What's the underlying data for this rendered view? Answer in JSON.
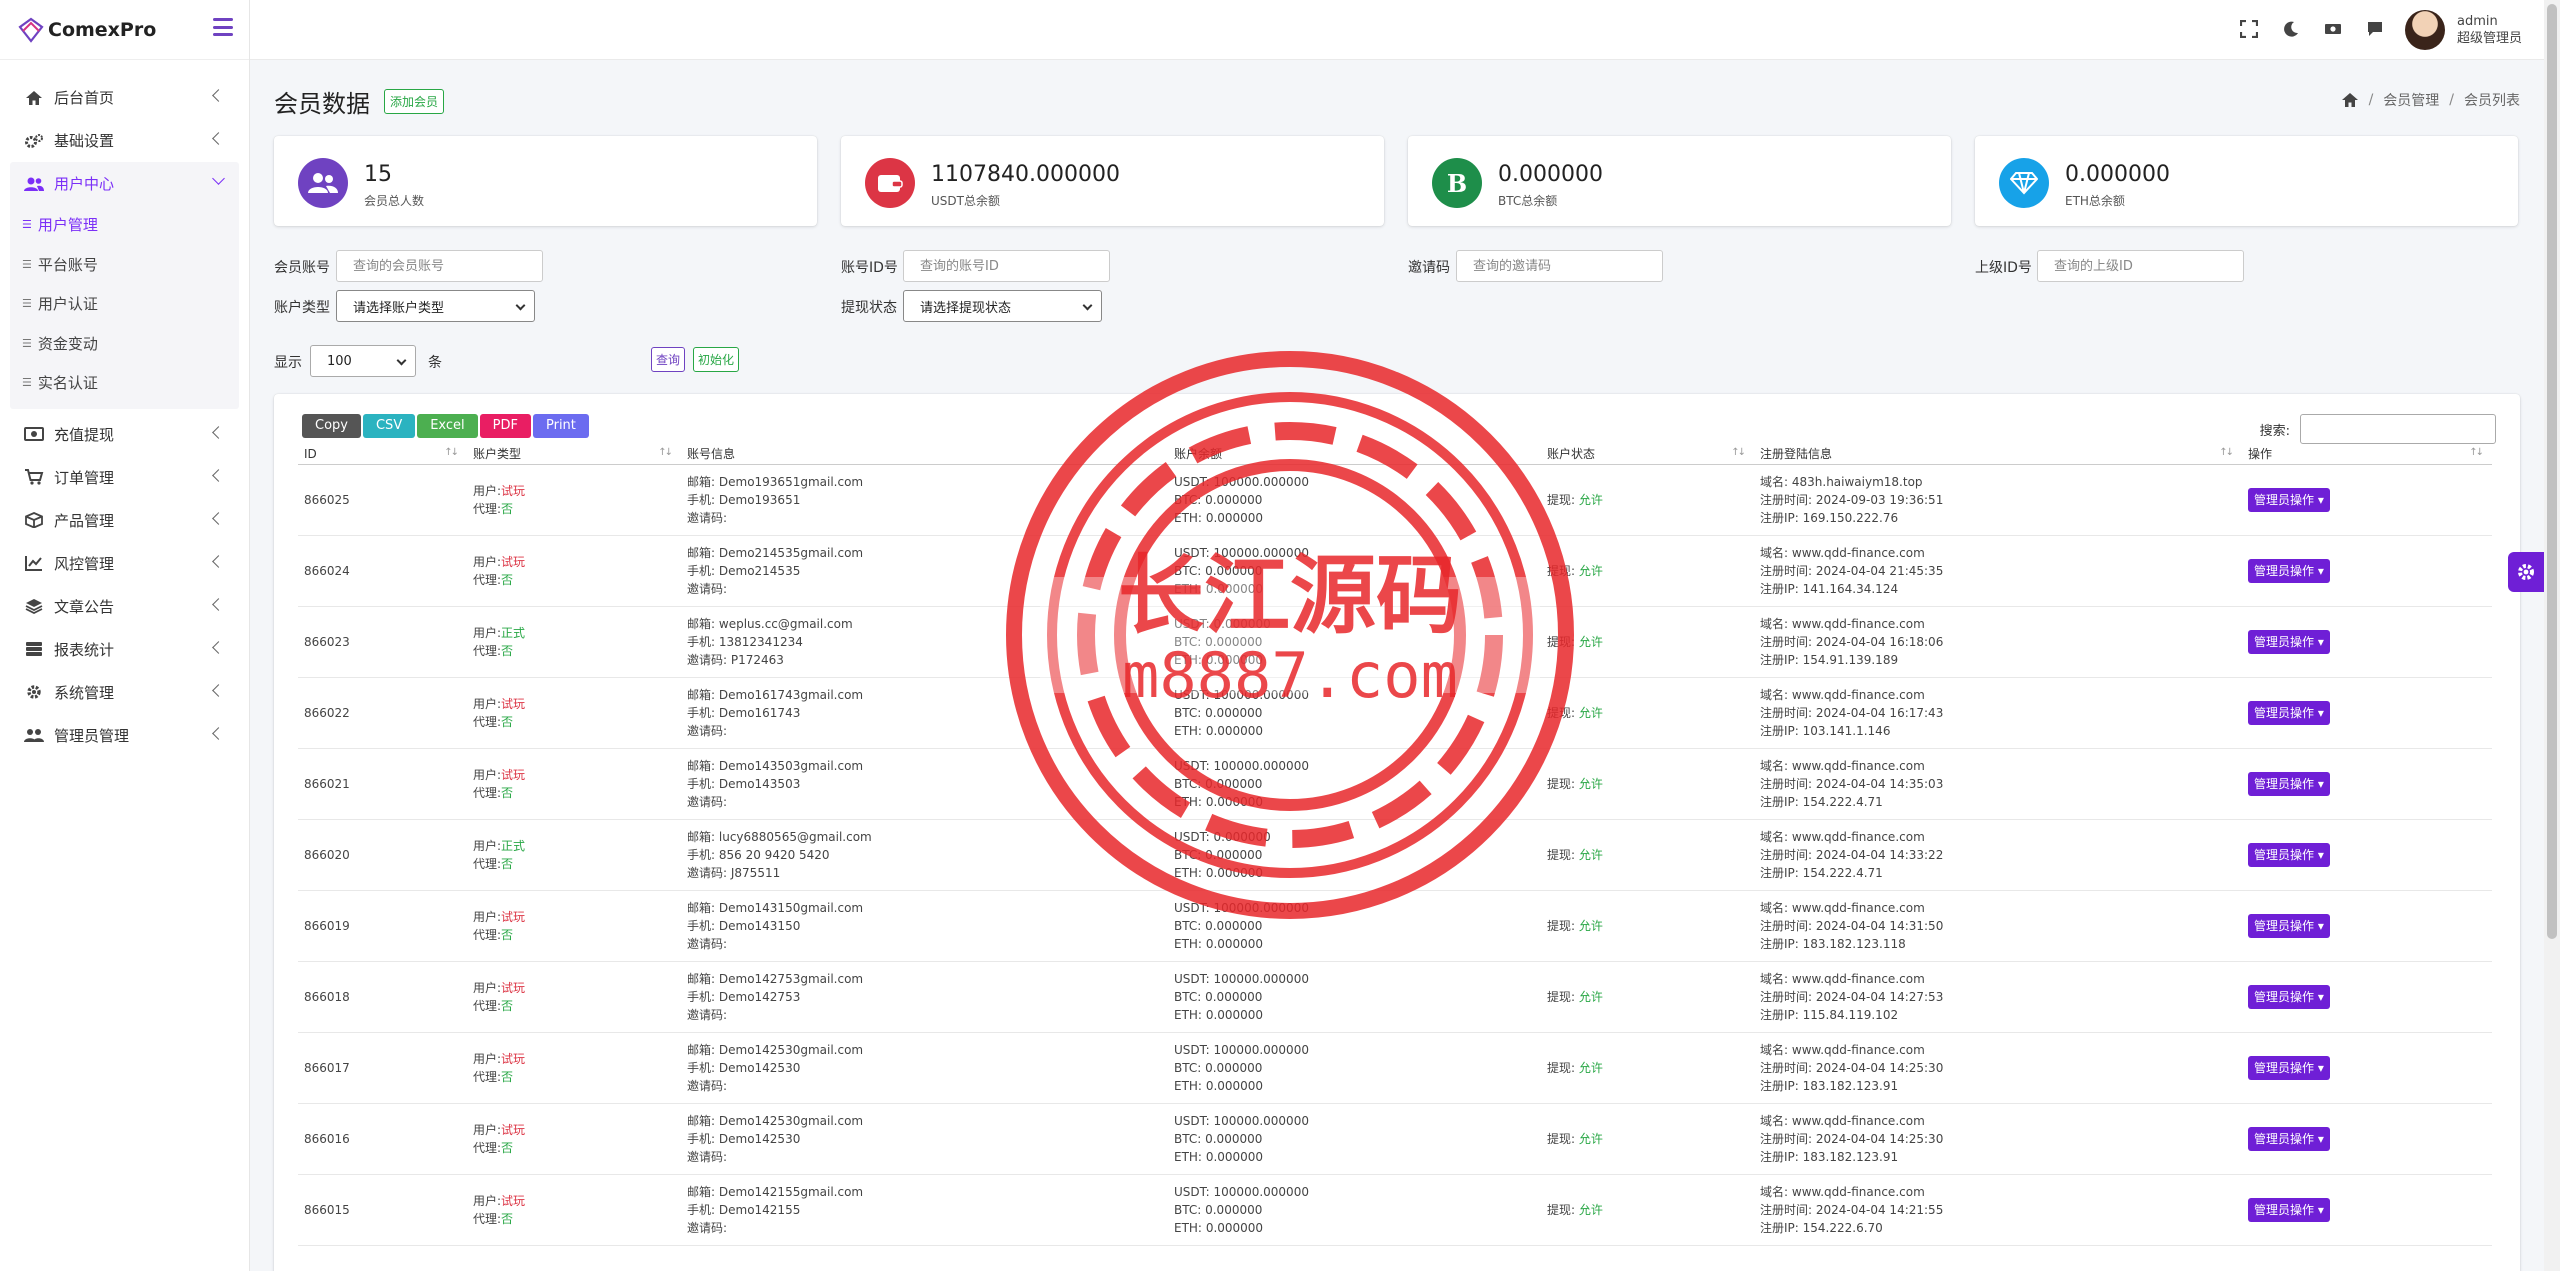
{
  "brand": {
    "name": "ComexPro"
  },
  "sidebar": {
    "items": [
      {
        "label": "后台首页",
        "icon": "home-icon"
      },
      {
        "label": "基础设置",
        "icon": "gears-icon"
      },
      {
        "label": "用户中心",
        "icon": "users-icon"
      },
      {
        "label": "充值提现",
        "icon": "money-icon"
      },
      {
        "label": "订单管理",
        "icon": "cart-icon"
      },
      {
        "label": "产品管理",
        "icon": "box-icon"
      },
      {
        "label": "风控管理",
        "icon": "chart-line-icon"
      },
      {
        "label": "文章公告",
        "icon": "layers-icon"
      },
      {
        "label": "报表统计",
        "icon": "database-icon"
      },
      {
        "label": "系统管理",
        "icon": "gear-icon"
      },
      {
        "label": "管理员管理",
        "icon": "users-cog-icon"
      }
    ],
    "submenu": [
      "用户管理",
      "平台账号",
      "用户认证",
      "资金变动",
      "实名认证"
    ]
  },
  "user": {
    "name": "admin",
    "role": "超级管理员"
  },
  "page": {
    "title": "会员数据",
    "add_button": "添加会员"
  },
  "breadcrumb": {
    "level1": "会员管理",
    "level2": "会员列表"
  },
  "stats": [
    {
      "value": "15",
      "label": "会员总人数",
      "color": "#6f42c1"
    },
    {
      "value": "1107840.000000",
      "label": "USDT总余额",
      "color": "#dc3545"
    },
    {
      "value": "0.000000",
      "label": "BTC总余额",
      "color": "#28a745",
      "glyph": "B"
    },
    {
      "value": "0.000000",
      "label": "ETH总余额",
      "color": "#17a2e8"
    }
  ],
  "filters": {
    "account_label": "会员账号",
    "account_placeholder": "查询的会员账号",
    "id_label": "账号ID号",
    "id_placeholder": "查询的账号ID",
    "invite_label": "邀请码",
    "invite_placeholder": "查询的邀请码",
    "parent_label": "上级ID号",
    "parent_placeholder": "查询的上级ID",
    "type_label": "账户类型",
    "type_value": "请选择账户类型",
    "withdraw_label": "提现状态",
    "withdraw_value": "请选择提现状态",
    "show_label": "显示",
    "show_value": "100",
    "show_unit": "条",
    "query_button": "查询",
    "reset_button": "初始化"
  },
  "table": {
    "export_buttons": [
      {
        "label": "Copy",
        "color": "#555555"
      },
      {
        "label": "CSV",
        "color": "#2bb3c0"
      },
      {
        "label": "Excel",
        "color": "#4caf50"
      },
      {
        "label": "PDF",
        "color": "#e91e63"
      },
      {
        "label": "Print",
        "color": "#6c6cf0"
      }
    ],
    "search_label": "搜索:",
    "columns": [
      "ID",
      "账户类型",
      "账号信息",
      "账户余额",
      "账户状态",
      "注册登陆信息",
      "操作"
    ],
    "action_label": "管理员操作",
    "rows": [
      {
        "id": "866025",
        "user_type": "试玩",
        "agent": "否",
        "email": "Demo193651gmail.com",
        "phone": "Demo193651",
        "invite": "",
        "usdt": "100000.000000",
        "btc": "0.000000",
        "eth": "0.000000",
        "withdraw": "允许",
        "domain": "483h.haiwaiym18.top",
        "reg_time": "2024-09-03 19:36:51",
        "reg_ip": "169.150.222.76"
      },
      {
        "id": "866024",
        "user_type": "试玩",
        "agent": "否",
        "email": "Demo214535gmail.com",
        "phone": "Demo214535",
        "invite": "",
        "usdt": "100000.000000",
        "btc": "0.000000",
        "eth": "0.000000",
        "withdraw": "允许",
        "domain": "www.qdd-finance.com",
        "reg_time": "2024-04-04 21:45:35",
        "reg_ip": "141.164.34.124"
      },
      {
        "id": "866023",
        "user_type": "正式",
        "agent": "否",
        "email": "weplus.cc@gmail.com",
        "phone": "13812341234",
        "invite": "P172463",
        "usdt": "0.000000",
        "btc": "0.000000",
        "eth": "0.000000",
        "withdraw": "允许",
        "domain": "www.qdd-finance.com",
        "reg_time": "2024-04-04 16:18:06",
        "reg_ip": "154.91.139.189"
      },
      {
        "id": "866022",
        "user_type": "试玩",
        "agent": "否",
        "email": "Demo161743gmail.com",
        "phone": "Demo161743",
        "invite": "",
        "usdt": "100000.000000",
        "btc": "0.000000",
        "eth": "0.000000",
        "withdraw": "允许",
        "domain": "www.qdd-finance.com",
        "reg_time": "2024-04-04 16:17:43",
        "reg_ip": "103.141.1.146"
      },
      {
        "id": "866021",
        "user_type": "试玩",
        "agent": "否",
        "email": "Demo143503gmail.com",
        "phone": "Demo143503",
        "invite": "",
        "usdt": "100000.000000",
        "btc": "0.000000",
        "eth": "0.000000",
        "withdraw": "允许",
        "domain": "www.qdd-finance.com",
        "reg_time": "2024-04-04 14:35:03",
        "reg_ip": "154.222.4.71"
      },
      {
        "id": "866020",
        "user_type": "正式",
        "agent": "否",
        "email": "lucy6880565@gmail.com",
        "phone": "856 20 9420 5420",
        "invite": "J875511",
        "usdt": "0.000000",
        "btc": "0.000000",
        "eth": "0.000000",
        "withdraw": "允许",
        "domain": "www.qdd-finance.com",
        "reg_time": "2024-04-04 14:33:22",
        "reg_ip": "154.222.4.71"
      },
      {
        "id": "866019",
        "user_type": "试玩",
        "agent": "否",
        "email": "Demo143150gmail.com",
        "phone": "Demo143150",
        "invite": "",
        "usdt": "100000.000000",
        "btc": "0.000000",
        "eth": "0.000000",
        "withdraw": "允许",
        "domain": "www.qdd-finance.com",
        "reg_time": "2024-04-04 14:31:50",
        "reg_ip": "183.182.123.118"
      },
      {
        "id": "866018",
        "user_type": "试玩",
        "agent": "否",
        "email": "Demo142753gmail.com",
        "phone": "Demo142753",
        "invite": "",
        "usdt": "100000.000000",
        "btc": "0.000000",
        "eth": "0.000000",
        "withdraw": "允许",
        "domain": "www.qdd-finance.com",
        "reg_time": "2024-04-04 14:27:53",
        "reg_ip": "115.84.119.102"
      },
      {
        "id": "866017",
        "user_type": "试玩",
        "agent": "否",
        "email": "Demo142530gmail.com",
        "phone": "Demo142530",
        "invite": "",
        "usdt": "100000.000000",
        "btc": "0.000000",
        "eth": "0.000000",
        "withdraw": "允许",
        "domain": "www.qdd-finance.com",
        "reg_time": "2024-04-04 14:25:30",
        "reg_ip": "183.182.123.91"
      },
      {
        "id": "866016",
        "user_type": "试玩",
        "agent": "否",
        "email": "Demo142530gmail.com",
        "phone": "Demo142530",
        "invite": "",
        "usdt": "100000.000000",
        "btc": "0.000000",
        "eth": "0.000000",
        "withdraw": "允许",
        "domain": "www.qdd-finance.com",
        "reg_time": "2024-04-04 14:25:30",
        "reg_ip": "183.182.123.91"
      },
      {
        "id": "866015",
        "user_type": "试玩",
        "agent": "否",
        "email": "Demo142155gmail.com",
        "phone": "Demo142155",
        "invite": "",
        "usdt": "100000.000000",
        "btc": "0.000000",
        "eth": "0.000000",
        "withdraw": "允许",
        "domain": "www.qdd-finance.com",
        "reg_time": "2024-04-04 14:21:55",
        "reg_ip": "154.222.6.70"
      }
    ],
    "labels": {
      "user": "用户:",
      "agent": "代理:",
      "email": "邮箱:",
      "phone": "手机:",
      "invite": "邀请码:",
      "usdt": "USDT:",
      "btc": "BTC:",
      "eth": "ETH:",
      "withdraw": "提现:",
      "domain": "域名:",
      "reg_time": "注册时间:",
      "reg_ip": "注册IP:"
    }
  },
  "watermark": {
    "title": "长江源码",
    "url": "m8887.com"
  },
  "colors": {
    "accent": "#6f1fd6",
    "red": "#dc3545",
    "green": "#28a745"
  }
}
